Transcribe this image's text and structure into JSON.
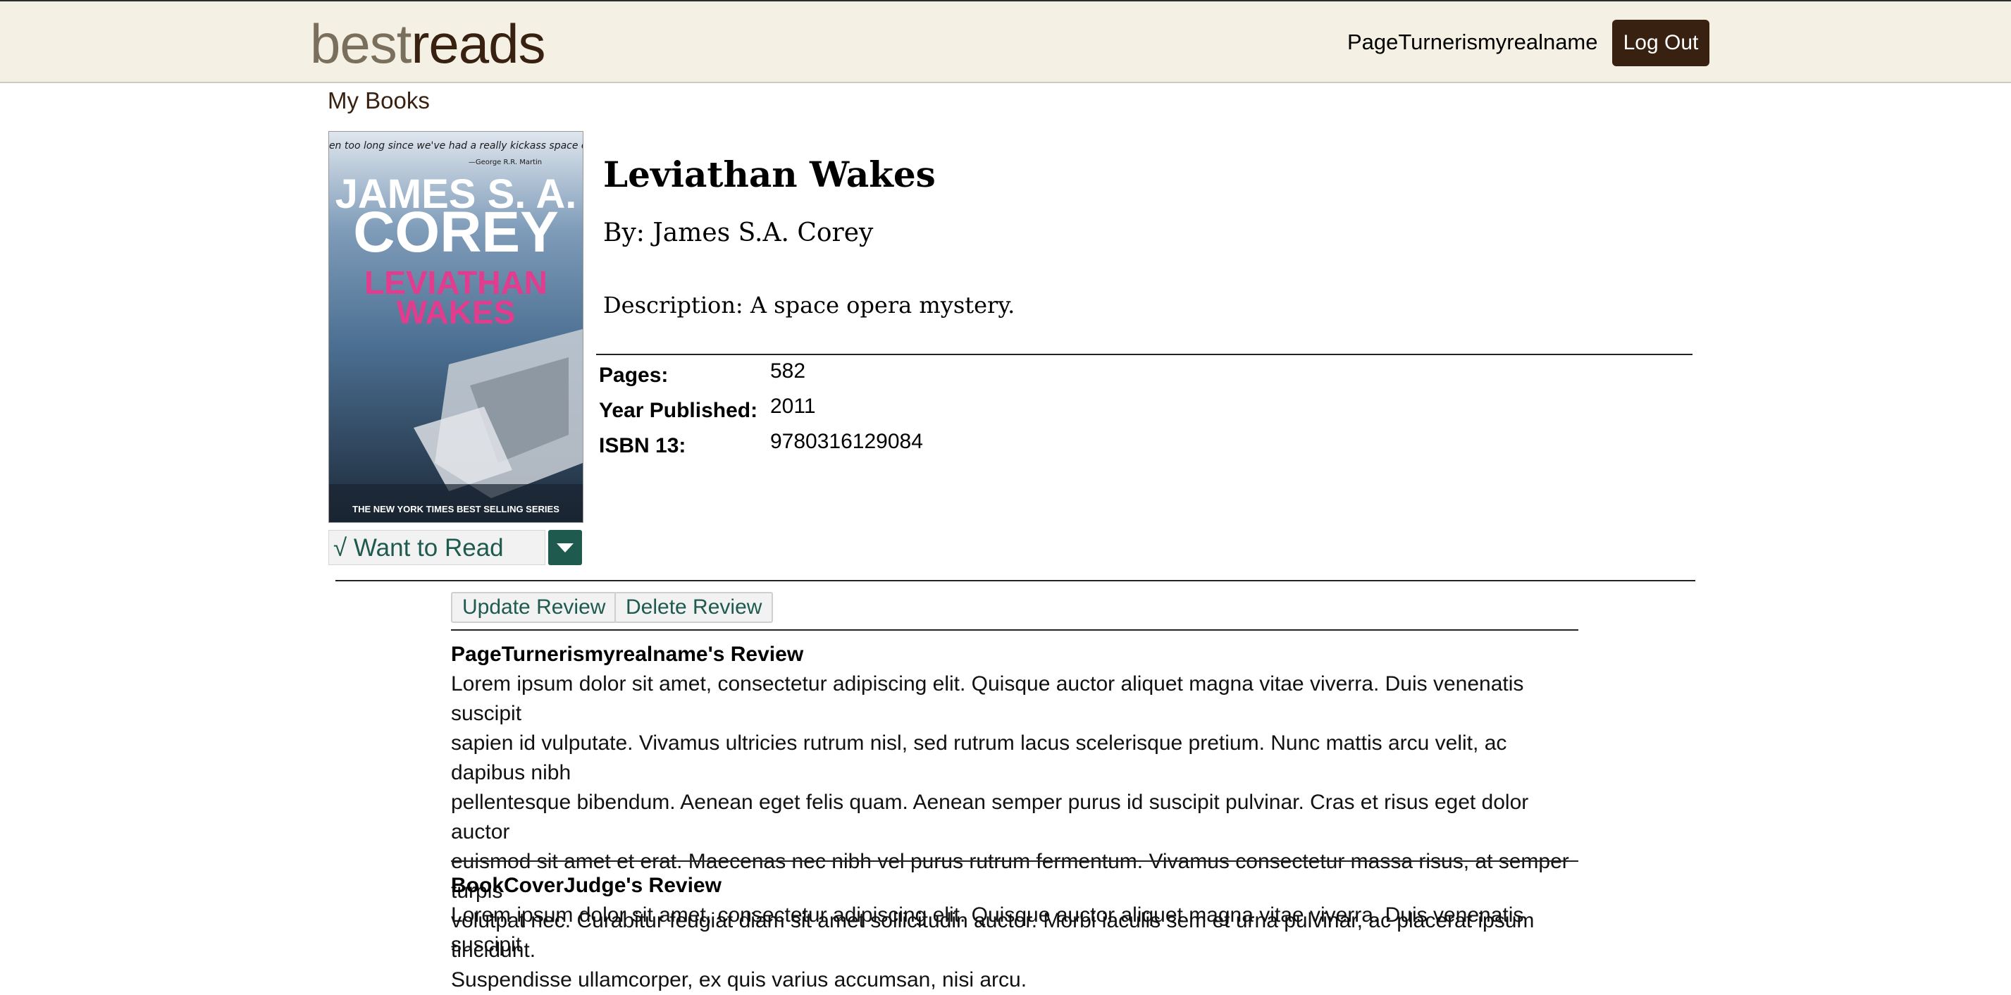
{
  "header": {
    "logo_part1": "best",
    "logo_part2": "reads",
    "username": "PageTurnerismyrealname",
    "logout_label": "Log Out"
  },
  "nav": {
    "my_books": "My Books"
  },
  "book": {
    "title": "Leviathan Wakes",
    "author_line": "By: James S.A. Corey",
    "description_line": "Description: A space opera mystery.",
    "cover": {
      "quote": "\"It's been too long since we've had a really kickass space opera.\"",
      "quote_attr": "—George R.R. Martin",
      "author_line1": "JAMES S. A.",
      "author_line2": "COREY",
      "title_line1": "LEVIATHAN",
      "title_line2": "WAKES",
      "banner": "THE NEW YORK TIMES BEST SELLING SERIES"
    },
    "details": [
      {
        "label": "Pages:",
        "value": "582"
      },
      {
        "label": "Year Published:",
        "value": "2011"
      },
      {
        "label": "ISBN 13:",
        "value": "9780316129084"
      }
    ]
  },
  "shelf": {
    "status": "√ Want to Read",
    "dropdown_icon": "chevron-down-icon"
  },
  "review_actions": {
    "update_label": "Update Review",
    "delete_label": "Delete Review"
  },
  "reviews": [
    {
      "heading": "PageTurnerismyrealname's Review",
      "lines": [
        "Lorem ipsum dolor sit amet, consectetur adipiscing elit. Quisque auctor aliquet magna vitae viverra. Duis venenatis suscipit",
        "sapien id vulputate. Vivamus ultricies rutrum nisl, sed rutrum lacus scelerisque pretium. Nunc mattis arcu velit, ac dapibus nibh",
        "pellentesque bibendum. Aenean eget felis quam. Aenean semper purus id suscipit pulvinar. Cras et risus eget dolor auctor",
        "euismod sit amet et erat. Maecenas nec nibh vel purus rutrum fermentum. Vivamus consectetur massa risus, at semper turpis",
        "volutpat nec. Curabitur feugiat diam sit amet sollicitudin auctor. Morbi iaculis sem et urna pulvinar, ac placerat ipsum tincidunt.",
        "Suspendisse ullamcorper, ex quis varius accumsan, nisi arcu."
      ]
    },
    {
      "heading": "BookCoverJudge's Review",
      "lines": [
        "Lorem ipsum dolor sit amet, consectetur adipiscing elit. Quisque auctor aliquet magna vitae viverra. Duis venenatis suscipit"
      ]
    }
  ],
  "colors": {
    "header_bg": "#f4f1e4",
    "brand_dark": "#382110",
    "accent_green": "#1e5a4e"
  }
}
